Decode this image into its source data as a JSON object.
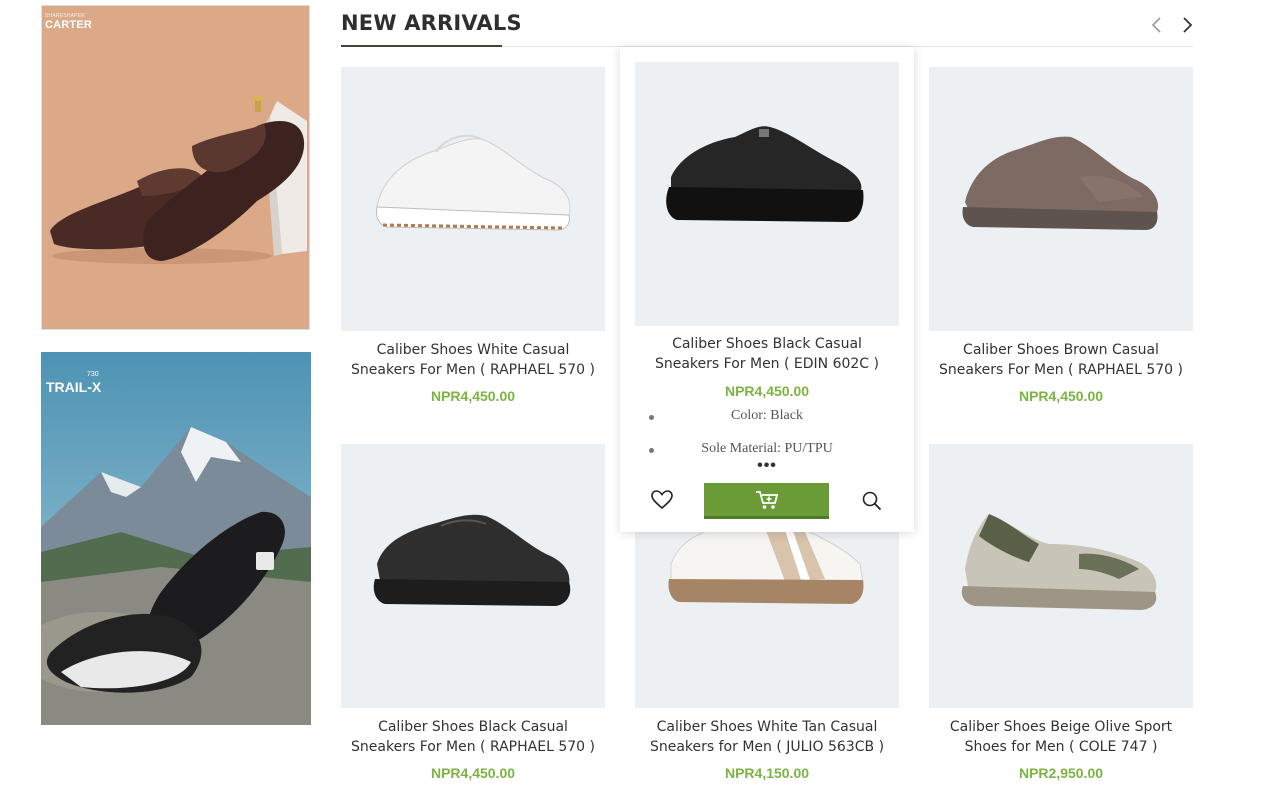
{
  "banners": [
    {
      "brand": "CARTER",
      "brand_small": "SHARESHAPER"
    },
    {
      "title": "TRAIL-X",
      "number": "730"
    }
  ],
  "section": {
    "title": "NEW ARRIVALS",
    "prev_icon": "chevron-left-icon",
    "next_icon": "chevron-right-icon"
  },
  "products": [
    {
      "name": "Caliber Shoes White Casual Sneakers For Men ( RAPHAEL 570 )",
      "line1": "Caliber Shoes White Casual",
      "line2": "Sneakers For Men ( RAPHAEL 570 )",
      "price": "NPR4,450.00",
      "color": "white"
    },
    {
      "name": "Caliber Shoes Black Casual Sneakers For Men ( EDIN 602C )",
      "line1": "Caliber Shoes Black Casual",
      "line2": "Sneakers For Men ( EDIN 602C )",
      "price": "NPR4,450.00",
      "color": "black",
      "specs": [
        "Color: Black",
        "Sole Material: PU/TPU"
      ],
      "more": "•••"
    },
    {
      "name": "Caliber Shoes Brown Casual Sneakers For Men ( RAPHAEL 570 )",
      "line1": "Caliber Shoes Brown Casual",
      "line2": "Sneakers For Men ( RAPHAEL 570 )",
      "price": "NPR4,450.00",
      "color": "brown"
    },
    {
      "name": "Caliber Shoes Black Casual Sneakers For Men ( RAPHAEL 570 )",
      "line1": "Caliber Shoes Black Casual",
      "line2": "Sneakers For Men ( RAPHAEL 570 )",
      "price": "NPR4,450.00",
      "color": "black"
    },
    {
      "name": "Caliber Shoes White Tan Casual Sneakers for Men ( JULIO 563CB )",
      "line1": "Caliber Shoes White Tan Casual",
      "line2": "Sneakers for Men ( JULIO 563CB )",
      "price": "NPR4,150.00",
      "color": "white-tan"
    },
    {
      "name": "Caliber Shoes Beige Olive Sport Shoes for Men ( COLE 747 )",
      "line1": "Caliber Shoes Beige Olive Sport",
      "line2": "Shoes for Men ( COLE 747 )",
      "price": "NPR2,950.00",
      "color": "beige-olive"
    }
  ],
  "actions": {
    "wishlist_icon": "heart-icon",
    "cart_icon": "cart-icon",
    "quickview_icon": "search-icon"
  },
  "colors": {
    "price": "#7cb342",
    "cart_button": "#6b9b37",
    "title_underline": "#3a4a33",
    "image_bg": "#edf0f3"
  }
}
